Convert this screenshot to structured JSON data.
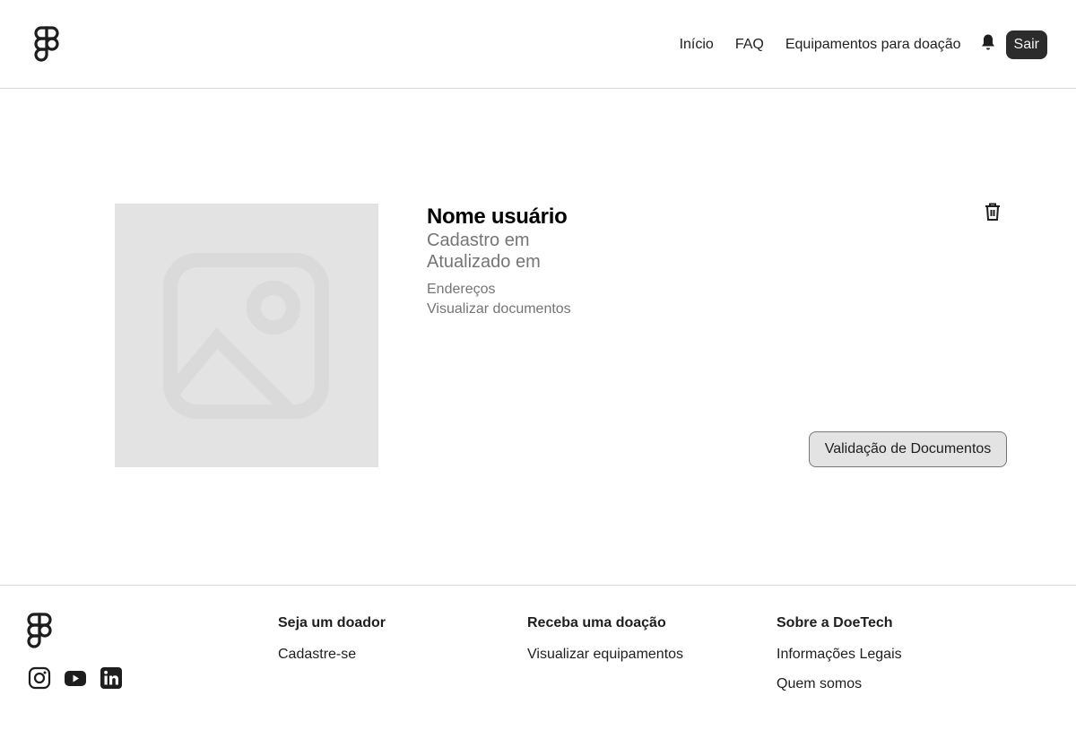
{
  "header": {
    "nav": {
      "inicio": "Início",
      "faq": "FAQ",
      "equipamentos": "Equipamentos para doação"
    },
    "logout_label": "Sair"
  },
  "profile": {
    "name": "Nome usuário",
    "registered": "Cadastro em",
    "updated": "Atualizado em",
    "addresses_link": "Endereços",
    "documents_link": "Visualizar documentos",
    "validate_button": "Validação de Documentos",
    "image_icon": "image-placeholder-icon",
    "delete_icon": "trash-icon"
  },
  "footer": {
    "socials": [
      "instagram-icon",
      "youtube-icon",
      "linkedin-icon"
    ],
    "columns": [
      {
        "title": "Seja um doador",
        "links": [
          "Cadastre-se"
        ]
      },
      {
        "title": "Receba uma doação",
        "links": [
          "Visualizar equipamentos"
        ]
      },
      {
        "title": "Sobre a DoeTech",
        "links": [
          "Informações Legais",
          "Quem somos"
        ]
      }
    ]
  },
  "colors": {
    "text": "#1e1e1e",
    "muted": "#757575",
    "placeholder_bg": "#e3e3e3",
    "button_dark": "#2c2c2c",
    "divider": "#d9d9d9"
  }
}
